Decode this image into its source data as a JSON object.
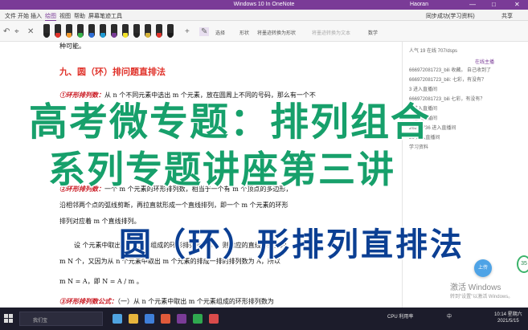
{
  "window": {
    "title": "Windows 10 In OneNote",
    "user": "Haoran",
    "min_glyph": "—",
    "max_glyph": "□",
    "close_glyph": "✕"
  },
  "ribbon": {
    "tabs": [
      "文件",
      "开始",
      "插入",
      "绘图",
      "视图",
      "帮助",
      "屏幕笔迹工具"
    ],
    "active_tab": "绘图",
    "right_label": "同步成功(学习资料)",
    "share_label": "共享"
  },
  "toolbar": {
    "lasso_label": "选择",
    "shape_label": "形状",
    "ink_to_shape_label": "将墨迹转换为形状",
    "ink_to_text_label": "将墨迹转换为文本",
    "math_label": "数学",
    "pen_colors": [
      "#222222",
      "#e0322a",
      "#f29a2e",
      "#36b34a",
      "#2f6fd6",
      "#1f9bd4",
      "#7a3b97",
      "#f2e22a",
      "#222222",
      "#d6b33a",
      "#e0322a",
      "#1a1a1a"
    ]
  },
  "document": {
    "line_top": "种可能。",
    "heading": "九、圆（环）排问题直排法",
    "p1_label": "①环形排列数：",
    "p1_text": "从 n 个不同元素中选出 m 个元素，放在圆周上不同的号码，那么有一个不",
    "p2_label": "②环形排列数：",
    "p2_text": "一个 m 个元素的环形排列数，相当于一个有 m 个顶点的多边形，",
    "p3_text": "沿相邻两个点的弧线剪断，再拉直就形成一个直线排列，即一个 m 个元素的环形",
    "p4_text": "排列对应着 m 个直线排列。",
    "p5_text": "设 个元素中取出 m 个元素组成的环形排列数为 N，则对应的直线排列数为",
    "p6_text": "m N 个，又因为从 n 个元素中取出 m 个元素的排成一排的排列数为 A，所以",
    "p7_text": "m N = A，即 N = A / m 。",
    "p8_label": "③环形排列数公式：",
    "p8_text": "（一）从 n 个元素中取出 m 个元素组成的环形排列数为"
  },
  "side_panel": {
    "lines": [
      "人气 19    在线 707/dsps",
      "666972081723_bili 收藏。 自己收到了",
      "666972081723_bili: 七彩，有没有？",
      "3  进入直播间",
      "666972081723_bili 七彩，有没有？",
      "3  进入直播间",
      "2  进入直播间",
      "26267736 进入直播间",
      "26  进入直播间",
      "学习资料"
    ],
    "follow_label": "在线主播",
    "round_button": "上传",
    "speed_value": "35",
    "activate_line1": "激活 Windows",
    "activate_line2": "转到\"设置\"以激活 Windows。"
  },
  "overlay": {
    "line1": "高考微专题：排列组合",
    "line2": "系列专题讲座第三讲",
    "line3": "圆（环）形排列直排法"
  },
  "taskbar": {
    "search_placeholder": "在这里输入你要搜索的内容",
    "search_text": "我们宝",
    "tray_cpu": "CPU 利用率",
    "tray_lang": "中",
    "time": "10:14 星期六",
    "date": "2021/5/15",
    "app_colors": [
      "#4fa3e0",
      "#e7b53c",
      "#3f7fd8",
      "#e05a3a",
      "#7a3b97",
      "#2fa84f",
      "#d94b4b"
    ]
  }
}
